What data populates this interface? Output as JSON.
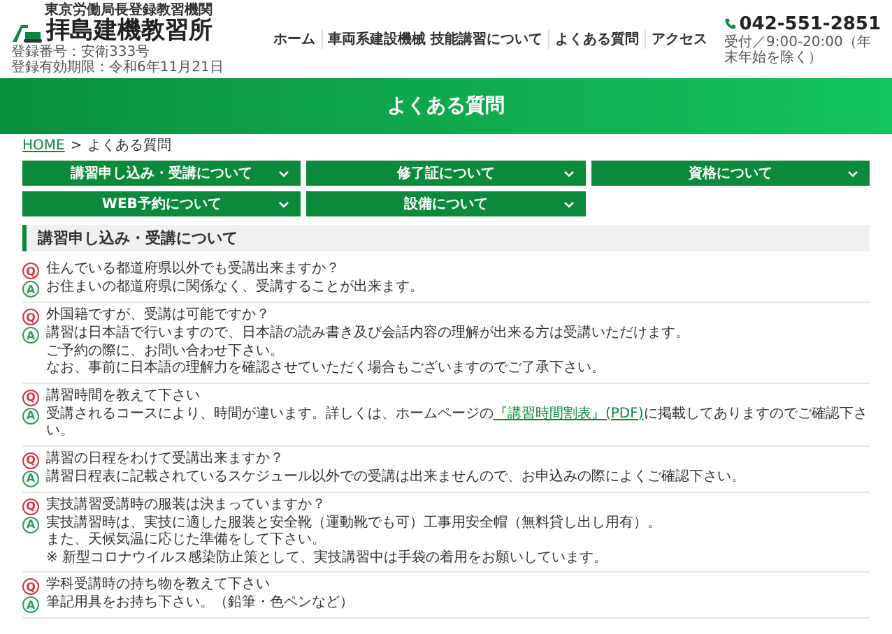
{
  "header": {
    "org_label": "東京労働局長登録教習機関",
    "logo_text": "拝島建機教習所",
    "registration": [
      "登録番号：安衛333号",
      "登録有効期限：令和6年11月21日"
    ],
    "nav": [
      {
        "label": "ホーム"
      },
      {
        "label": "車両系建設機械 技能講習について"
      },
      {
        "label": "よくある質問"
      },
      {
        "label": "アクセス"
      }
    ],
    "phone": "042-551-2851",
    "hours": "受付／9:00-20:00（年末年始を除く）"
  },
  "hero": {
    "title": "よくある質問"
  },
  "breadcrumb": {
    "home": "HOME",
    "separator": ">",
    "current": "よくある質問"
  },
  "categories": [
    {
      "label": "講習申し込み・受講について"
    },
    {
      "label": "修了証について"
    },
    {
      "label": "資格について"
    },
    {
      "label": "WEB予約について"
    },
    {
      "label": "設備について"
    }
  ],
  "section": {
    "title": "講習申し込み・受講について",
    "items": [
      {
        "question_mark": "Q",
        "question": "住んでいる都道府県以外でも受講出来ますか？",
        "answer_mark": "A",
        "answer": [
          [
            {
              "kind": "text",
              "text": "お住まいの都道府県に関係なく、受講することが出来ます。"
            }
          ]
        ]
      },
      {
        "question_mark": "Q",
        "question": "外国籍ですが、受講は可能ですか？",
        "answer_mark": "A",
        "answer": [
          [
            {
              "kind": "text",
              "text": "講習は日本語で行いますので、日本語の読み書き及び会話内容の理解が出来る方は受講いただけます。"
            }
          ],
          [
            {
              "kind": "text",
              "text": "ご予約の際に、お問い合わせ下さい。"
            }
          ],
          [
            {
              "kind": "text",
              "text": "なお、事前に日本語の理解力を確認させていただく場合もございますのでご了承下さい。"
            }
          ]
        ]
      },
      {
        "question_mark": "Q",
        "question": "講習時間を教えて下さい",
        "answer_mark": "A",
        "answer": [
          [
            {
              "kind": "text",
              "text": "受講されるコースにより、時間が違います。詳しくは、ホームページの"
            },
            {
              "kind": "link",
              "text": "『講習時間割表』(PDF)"
            },
            {
              "kind": "text",
              "text": "に掲載してありますのでご確認下さい。"
            }
          ]
        ]
      },
      {
        "question_mark": "Q",
        "question": "講習の日程をわけて受講出来ますか？",
        "answer_mark": "A",
        "answer": [
          [
            {
              "kind": "text",
              "text": "講習日程表に記載されているスケジュール以外での受講は出来ませんので、お申込みの際によくご確認下さい。"
            }
          ]
        ]
      },
      {
        "question_mark": "Q",
        "question": "実技講習受講時の服装は決まっていますか？",
        "answer_mark": "A",
        "answer": [
          [
            {
              "kind": "text",
              "text": "実技講習時は、実技に適した服装と安全靴（運動靴でも可）工事用安全帽（無料貸し出し用有）。"
            }
          ],
          [
            {
              "kind": "text",
              "text": "また、天候気温に応じた準備をして下さい。"
            }
          ],
          [
            {
              "kind": "text",
              "text": "※ 新型コロナウイルス感染防止策として、実技講習中は手袋の着用をお願いしています。"
            }
          ]
        ]
      },
      {
        "question_mark": "Q",
        "question": "学科受講時の持ち物を教えて下さい",
        "answer_mark": "A",
        "answer": [
          [
            {
              "kind": "text",
              "text": "筆記用具をお持ち下さい。（鉛筆・色ペンなど）"
            }
          ]
        ]
      }
    ]
  }
}
